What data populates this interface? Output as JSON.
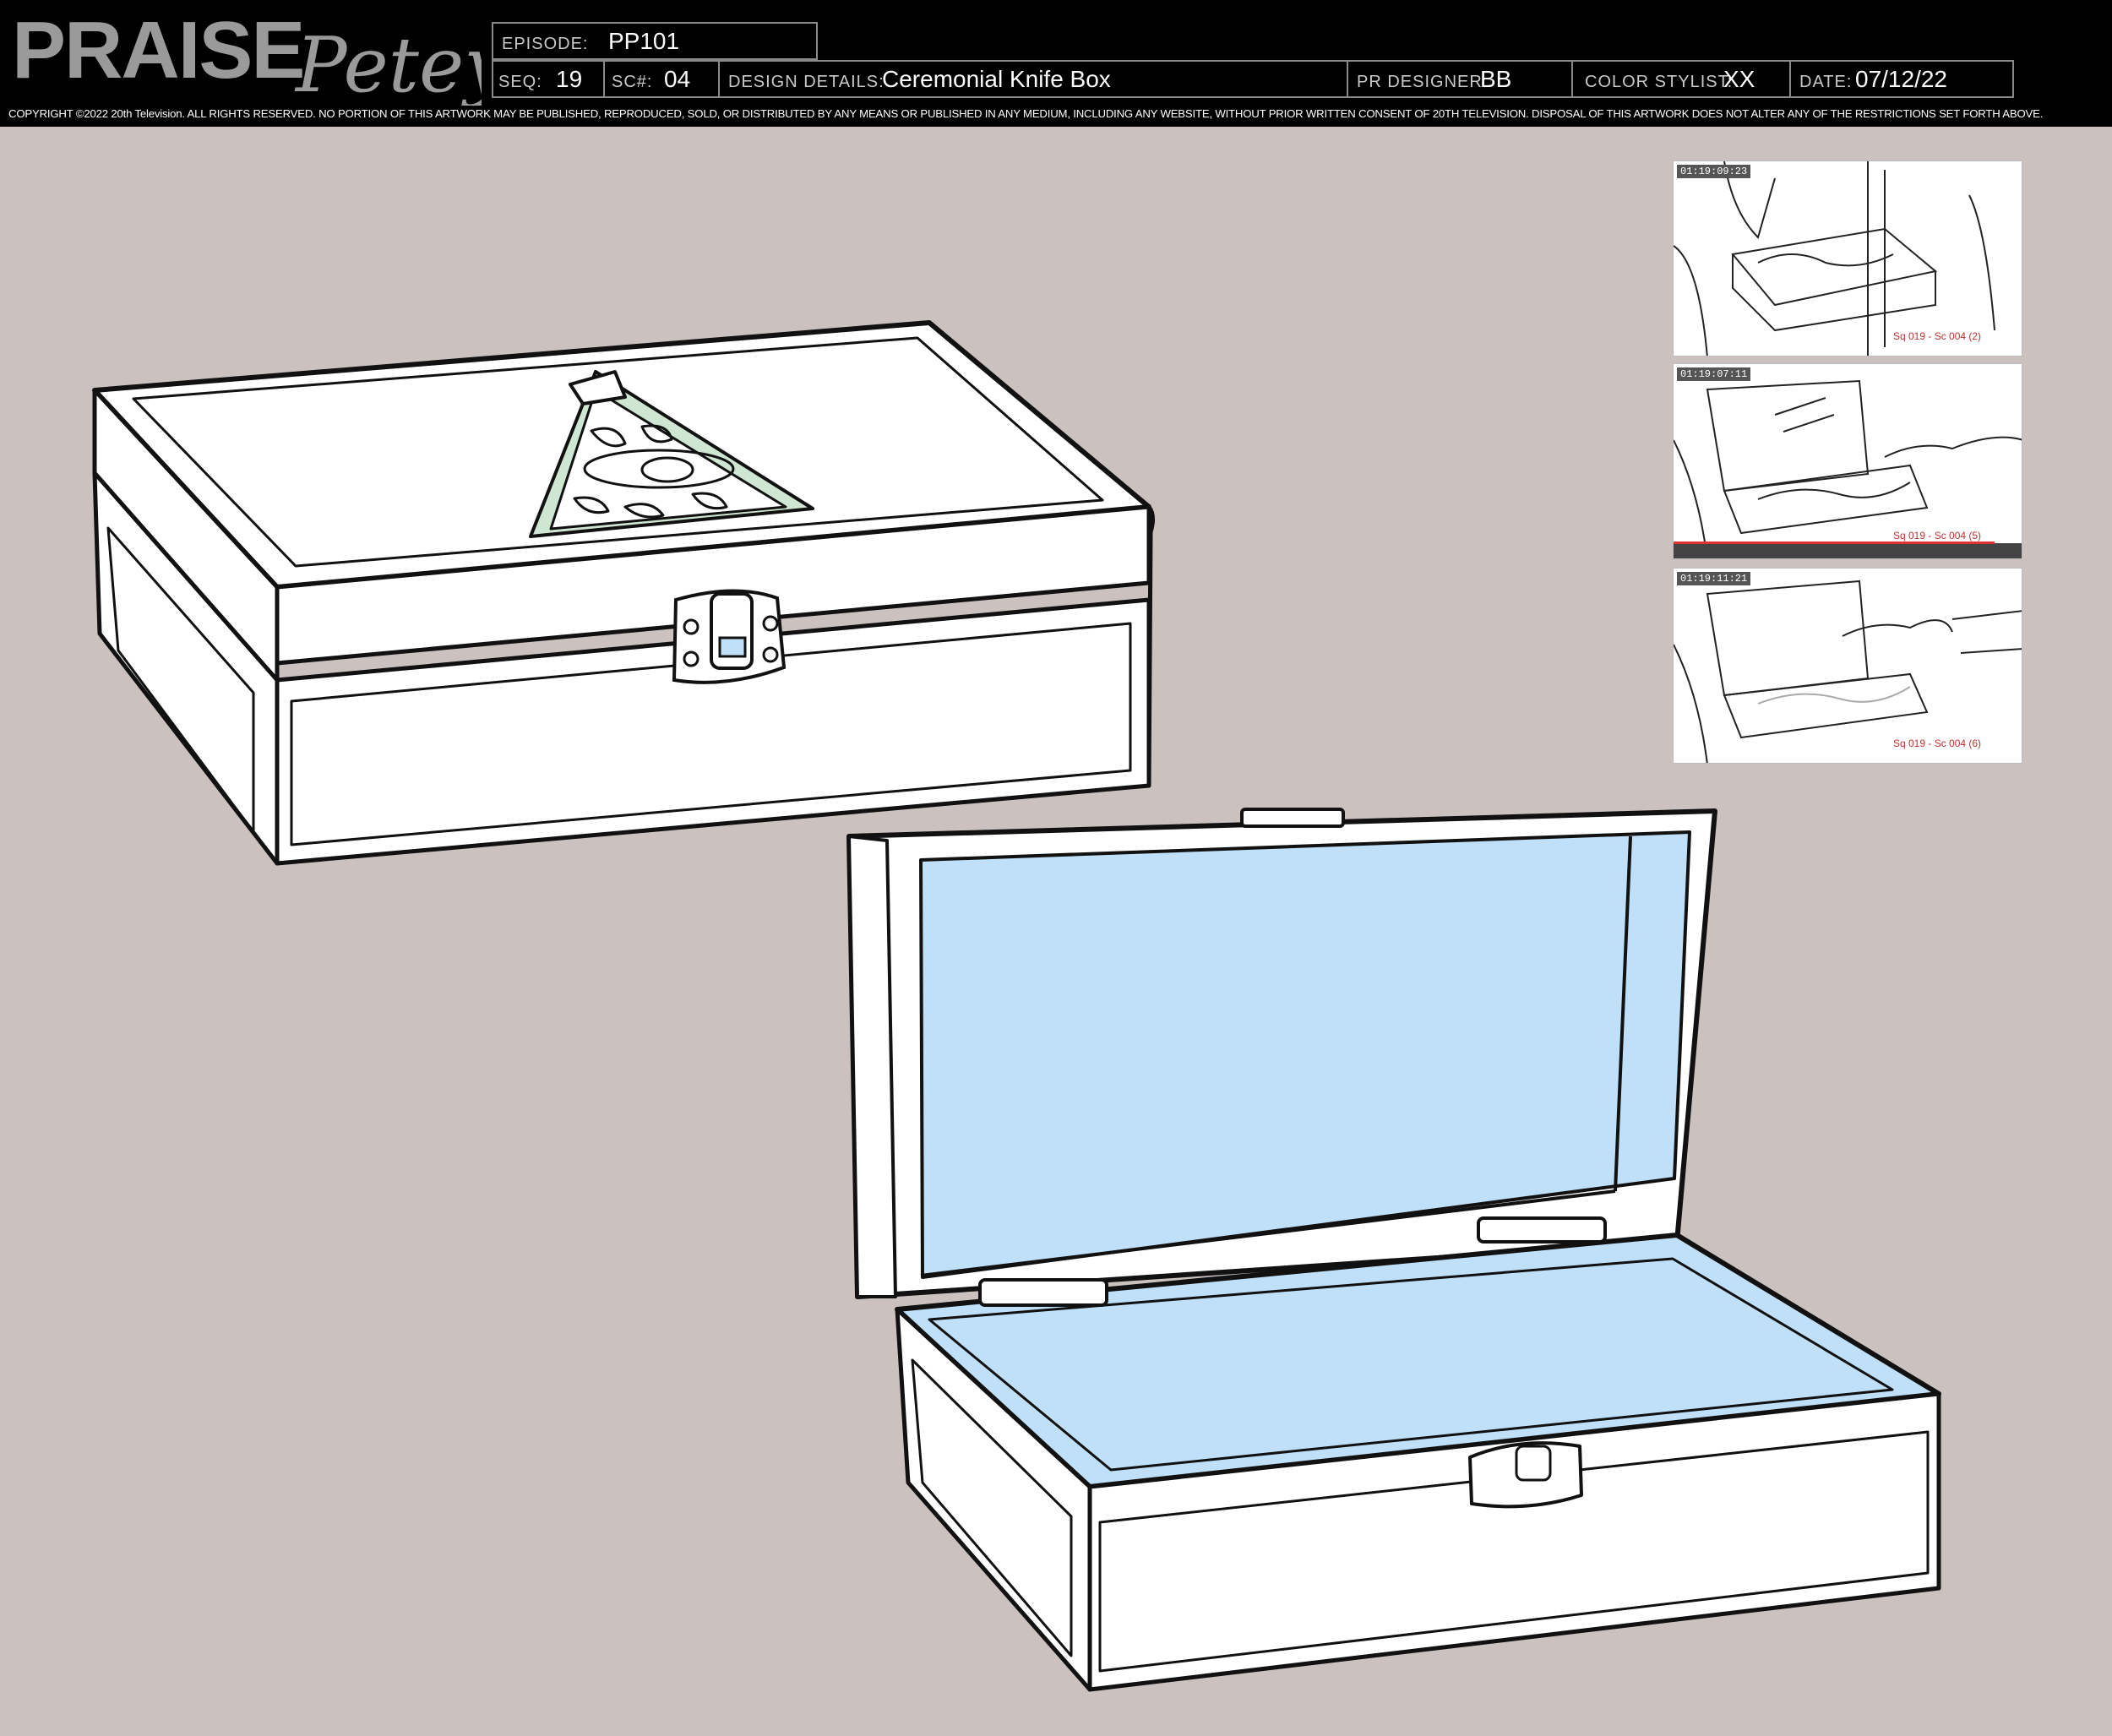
{
  "header": {
    "logo_text_1": "PRAISE",
    "logo_text_2": "Petey",
    "episode_label": "EPISODE:",
    "episode_value": "PP101",
    "seq_label": "SEQ:",
    "seq_value": "19",
    "sc_label": "SC#:",
    "sc_value": "04",
    "design_label": "DESIGN DETAILS:",
    "design_value": "Ceremonial Knife Box",
    "designer_label": "PR DESIGNER:",
    "designer_value": "BB",
    "stylist_label": "COLOR STYLIST:",
    "stylist_value": "XX",
    "date_label": "DATE:",
    "date_value": "07/12/22"
  },
  "copyright": "COPYRIGHT ©2022 20th Television. ALL RIGHTS RESERVED. NO PORTION OF THIS ARTWORK MAY BE PUBLISHED, REPRODUCED, SOLD, OR DISTRIBUTED BY ANY MEANS OR PUBLISHED IN ANY MEDIUM, INCLUDING ANY WEBSITE, WITHOUT PRIOR WRITTEN CONSENT OF 20TH TELEVISION. DISPOSAL OF THIS ARTWORK DOES NOT ALTER ANY OF THE RESTRICTIONS SET FORTH ABOVE.",
  "colors": {
    "background": "#cbc2c0",
    "header_bg": "#000000",
    "lining_blue": "#bfe0f8",
    "emblem_green": "#cfe6d2",
    "timecode_red": "#c03030"
  },
  "reference_panels": [
    {
      "timecode": "01:19:09:23",
      "caption": "Sq 019 - Sc 004 (2)"
    },
    {
      "timecode": "01:19:07:11",
      "caption": "Sq 019 - Sc 004 (5)"
    },
    {
      "timecode": "01:19:11:21",
      "caption": "Sq 019 - Sc 004 (6)"
    }
  ]
}
